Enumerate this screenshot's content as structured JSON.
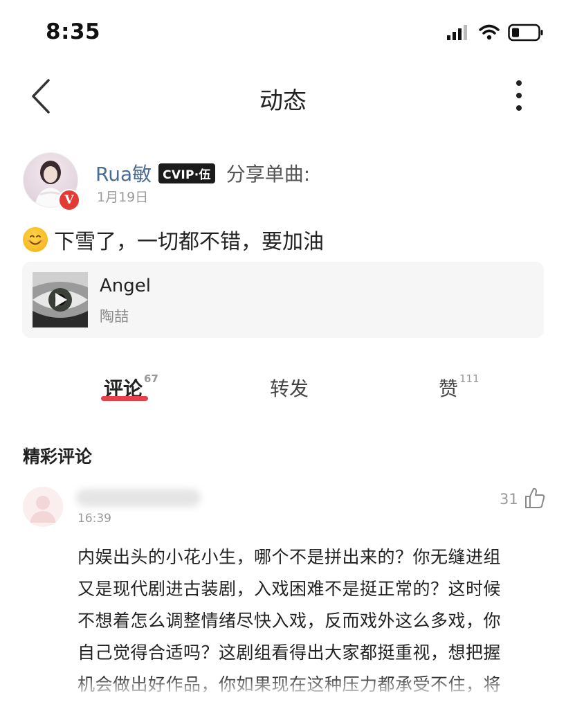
{
  "status_bar": {
    "time": "8:35",
    "icons": [
      "signal-icon",
      "wifi-icon",
      "battery-icon"
    ]
  },
  "header": {
    "title": "动态",
    "back_icon": "chevron-left-icon",
    "more_icon": "more-vertical-icon"
  },
  "post": {
    "author": "Rua敏",
    "vip_badge": "CVIP·伍",
    "verified_badge": "V",
    "share_label": "分享单曲:",
    "date": "1月19日",
    "emoji": "smiling-face-emoji",
    "text": "下雪了，一切都不错，要加油"
  },
  "music_card": {
    "title": "Angel",
    "artist": "陶喆",
    "cover_icon": "eye-cover-image",
    "play_icon": "play-icon"
  },
  "tabs": [
    {
      "label": "评论",
      "count": "67",
      "active": true
    },
    {
      "label": "转发",
      "count": "",
      "active": false
    },
    {
      "label": "赞",
      "count": "111",
      "active": false
    }
  ],
  "colors": {
    "accent": "#e7404a",
    "author_name": "#4a6b93",
    "verified": "#e23b36"
  },
  "section_title": "精彩评论",
  "comment": {
    "time": "16:39",
    "likes": "31",
    "like_icon": "thumbs-up-icon",
    "lines": [
      "内娱出头的小花小生，哪个不是拼出来的？你无缝进组",
      "又是现代剧进古装剧，入戏困难不是挺正常的？这时候",
      "不想着怎么调整情绪尽快入戏，反而戏外这么多戏，你",
      "自己觉得合适吗？这剧组看得出大家都挺重视，想把握",
      "机会做出好作品，你如果现在这种压力都承受不住，将"
    ]
  }
}
